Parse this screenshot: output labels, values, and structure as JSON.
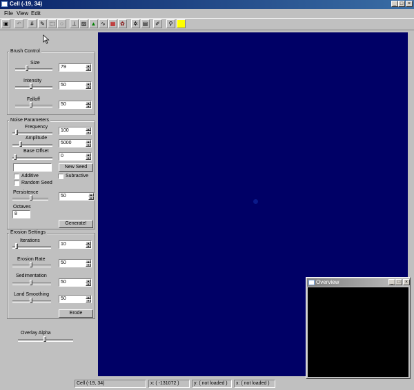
{
  "window": {
    "title": "Cell (-19, 34)"
  },
  "menu": [
    "File",
    "View",
    "Edit"
  ],
  "toolbar": {
    "color_swatch": "#ffff00"
  },
  "brush": {
    "title": "Brush Control",
    "size_label": "Size",
    "size_value": "79",
    "intensity_label": "Intensity",
    "intensity_value": "50",
    "falloff_label": "Falloff",
    "falloff_value": "50"
  },
  "noise": {
    "title": "Noise Parameters",
    "frequency_label": "Frequency",
    "frequency_value": "100",
    "amplitude_label": "Amplitude",
    "amplitude_value": "5000",
    "base_offset_label": "Base Offset",
    "base_offset_value": "0",
    "new_seed_label": "New Seed",
    "additive_label": "Additive",
    "subtractive_label": "Subractive",
    "random_seed_label": "Random Seed",
    "persistence_label": "Persistence",
    "persistence_value": "50",
    "octaves_label": "Octaves",
    "octaves_value": "8",
    "generate_label": "Generate!"
  },
  "erosion": {
    "title": "Erosion Settings",
    "iterations_label": "Iterations",
    "iterations_value": "10",
    "rate_label": "Erosion Rate",
    "rate_value": "50",
    "sedimentation_label": "Sedimentation",
    "sedimentation_value": "50",
    "smoothing_label": "Land Smoothing",
    "smoothing_value": "50",
    "erode_label": "Erode"
  },
  "overlay": {
    "label": "Overlay Alpha"
  },
  "overview": {
    "title": "Overview"
  },
  "status": {
    "cell": "Cell (-19, 34)",
    "x": "x: ( -131072 )",
    "y": "y: ( not loaded )",
    "x2": "x: ( not loaded )"
  }
}
